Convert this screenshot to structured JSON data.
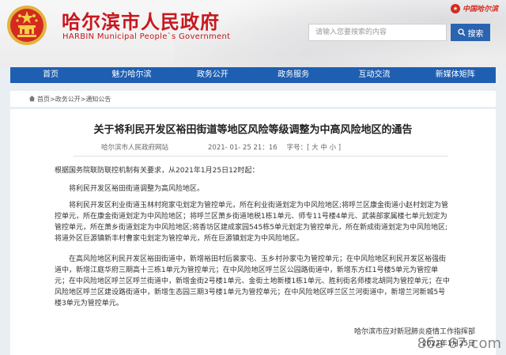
{
  "header": {
    "title": "哈尔滨市人民政府",
    "subtitle": "HARBIN Municipal People`s Government",
    "top_logo": "中国哈尔滨",
    "search": {
      "placeholder": "请输入您要搜索的内容",
      "button_label": "搜索"
    }
  },
  "nav": {
    "items": [
      "首页",
      "魅力哈尔滨",
      "政务公开",
      "政务服务",
      "互动交流",
      "新媒体矩阵"
    ]
  },
  "breadcrumb": {
    "home": "首页",
    "sep1": ">",
    "level1": "政务公开",
    "sep2": ">",
    "level2": "通知公告"
  },
  "article": {
    "title": "关于将利民开发区裕田街道等地区风险等级调整为中高风险地区的通告",
    "source": "哈尔滨市人民政府网站",
    "date": "2021- 01- 25   21：16",
    "font_label": "字号：[ 大 中 小 ]",
    "paragraphs": [
      "根据国务院联防联控机制有关要求，从2021年1月25日12时起：",
      "将利民开发区裕田街道调整为高风险地区。",
      "将利民开发区利业街道玉林村宛家屯划定为管控单元，所在利业街道划定为中风险地区;将呼兰区康金街道小赵村划定为管控单元，所在康金街道划定为中风险地区；将呼兰区萧乡街道地税1栋1单元、师专11号楼4单元、武装部家属楼七单元划定为管控单元，所在萧乡街道划定为中风险地区;将香坊区建成家园545栋5单元划定为管控单元，所在新成街道划定为中风险地区;将道外区巨源镇新丰村曹家屯划定为管控单元，所在巨源镇划定为中风险地区。",
      "在高风险地区利民开发区裕田街道中，新增裕田村后裴家屯、玉乡村孙家屯为管控单元；在中风险地区利民开发区裕强街道中，新增江庭华府三期高十三栋1单元为管控单元；在中风险地区呼兰区公园路街道中，新增东方红1号楼5单元为管控单元；在中风险地区呼兰区呼兰街道中，新增金街2号楼1单元、金街土地新楼1栋1单元、胜利街名师楼北胡同为管控单元；在中风险地区呼兰区建设路街道中，新增生态园三期3号楼1单元为管控单元；在中风险地区呼兰区兰河街道中，新增兰河新城5号楼3单元为管控单元。"
    ],
    "signature_org": "哈尔滨市应对新冠肺炎疫情工作指挥部",
    "signature_date": "2021年1月25日"
  },
  "watermark": "8ба  67.com",
  "colors": {
    "brand_red": "#c8171e",
    "nav_blue": "#1f5fb2",
    "search_blue": "#2a64b0"
  }
}
